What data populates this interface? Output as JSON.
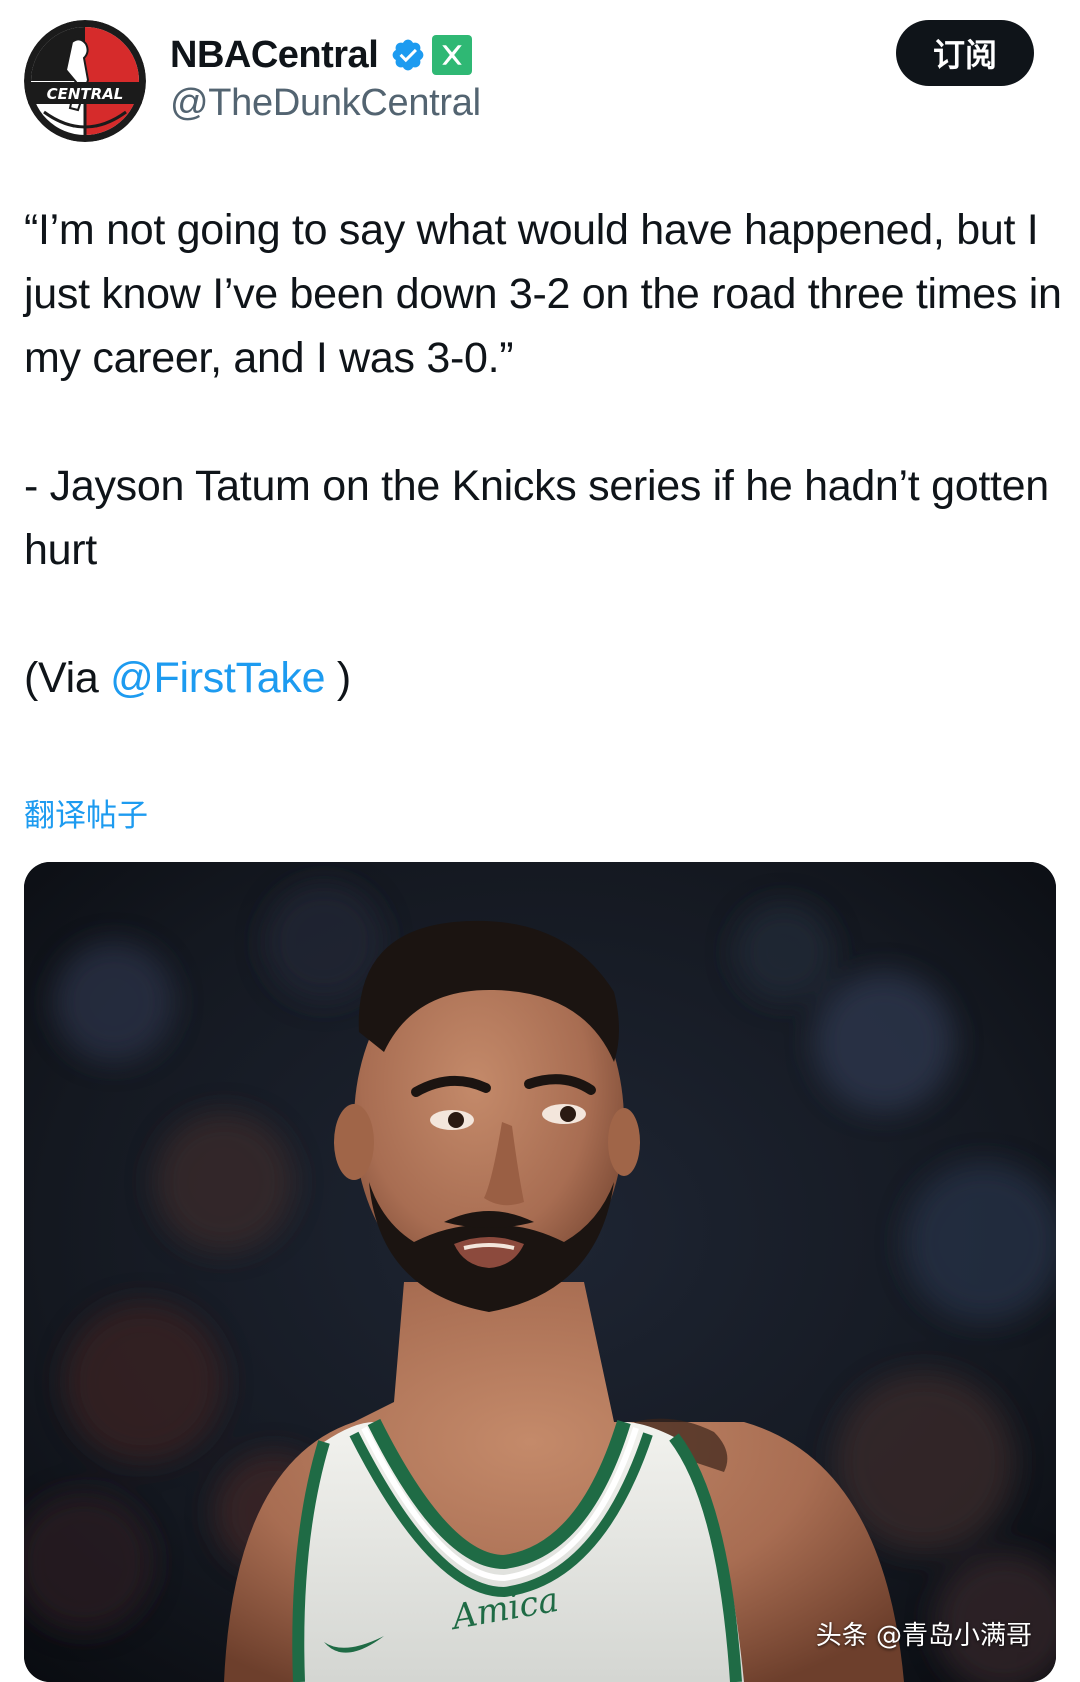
{
  "account": {
    "display_name": "NBACentral",
    "handle": "@TheDunkCentral",
    "avatar_text": "CENTRAL"
  },
  "subscribe_button": {
    "label": "订阅"
  },
  "tweet": {
    "quote": "“I’m not going to say what would have happened, but I just know I’ve been down 3-2 on the road three times in my career, and I was 3-0.”",
    "attribution": "- Jayson Tatum on the Knicks series if he hadn’t gotten hurt",
    "via_prefix": "(Via ",
    "via_mention": "@FirstTake",
    "via_suffix": " )"
  },
  "translate_link": "翻译帖子",
  "media": {
    "jersey_text": "Amica",
    "watermark": "头条 @青岛小满哥"
  },
  "colors": {
    "link": "#1d9bf0",
    "text": "#0f1419",
    "secondary": "#536471",
    "button_bg": "#0f1419",
    "verified": "#1d9bf0",
    "x_badge": "#2fb874",
    "celtics_green": "#1f6b45"
  },
  "icons": {
    "verified": "verified-check-icon",
    "x": "x-logo-icon"
  }
}
